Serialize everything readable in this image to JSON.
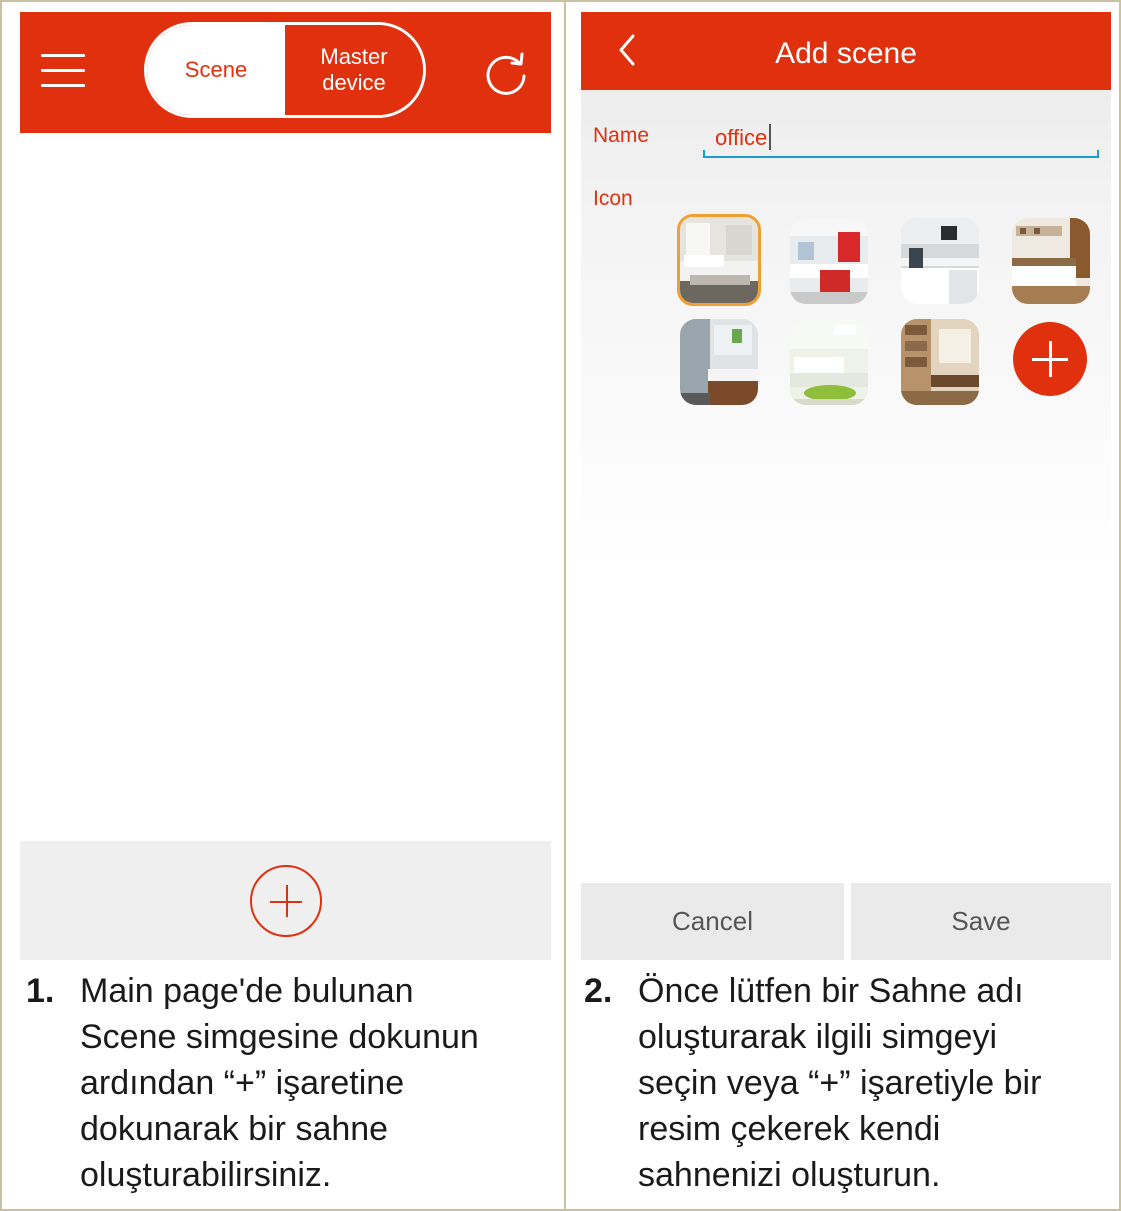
{
  "colors": {
    "accent": "#e0300e",
    "input_underline": "#1a9bd6",
    "selected_border": "#f0a033"
  },
  "main_page": {
    "toggle": {
      "scene_label": "Scene",
      "master_line1": "Master",
      "master_line2": "device"
    }
  },
  "add_scene": {
    "title": "Add scene",
    "name_label": "Name",
    "name_value": "office",
    "icon_label": "Icon",
    "cancel_label": "Cancel",
    "save_label": "Save"
  },
  "captions": {
    "left": {
      "number": "1.",
      "lines": [
        "Main page'de bulunan",
        "Scene simgesine dokunun",
        "ardından “+” işaretine",
        "dokunarak bir sahne",
        "oluşturabilirsiniz."
      ]
    },
    "right": {
      "number": "2.",
      "lines": [
        "Önce lütfen bir Sahne adı",
        "oluşturarak ilgili simgeyi",
        "seçin veya “+” işaretiyle bir",
        "resim çekerek kendi",
        "sahnenizi oluşturun."
      ]
    }
  }
}
